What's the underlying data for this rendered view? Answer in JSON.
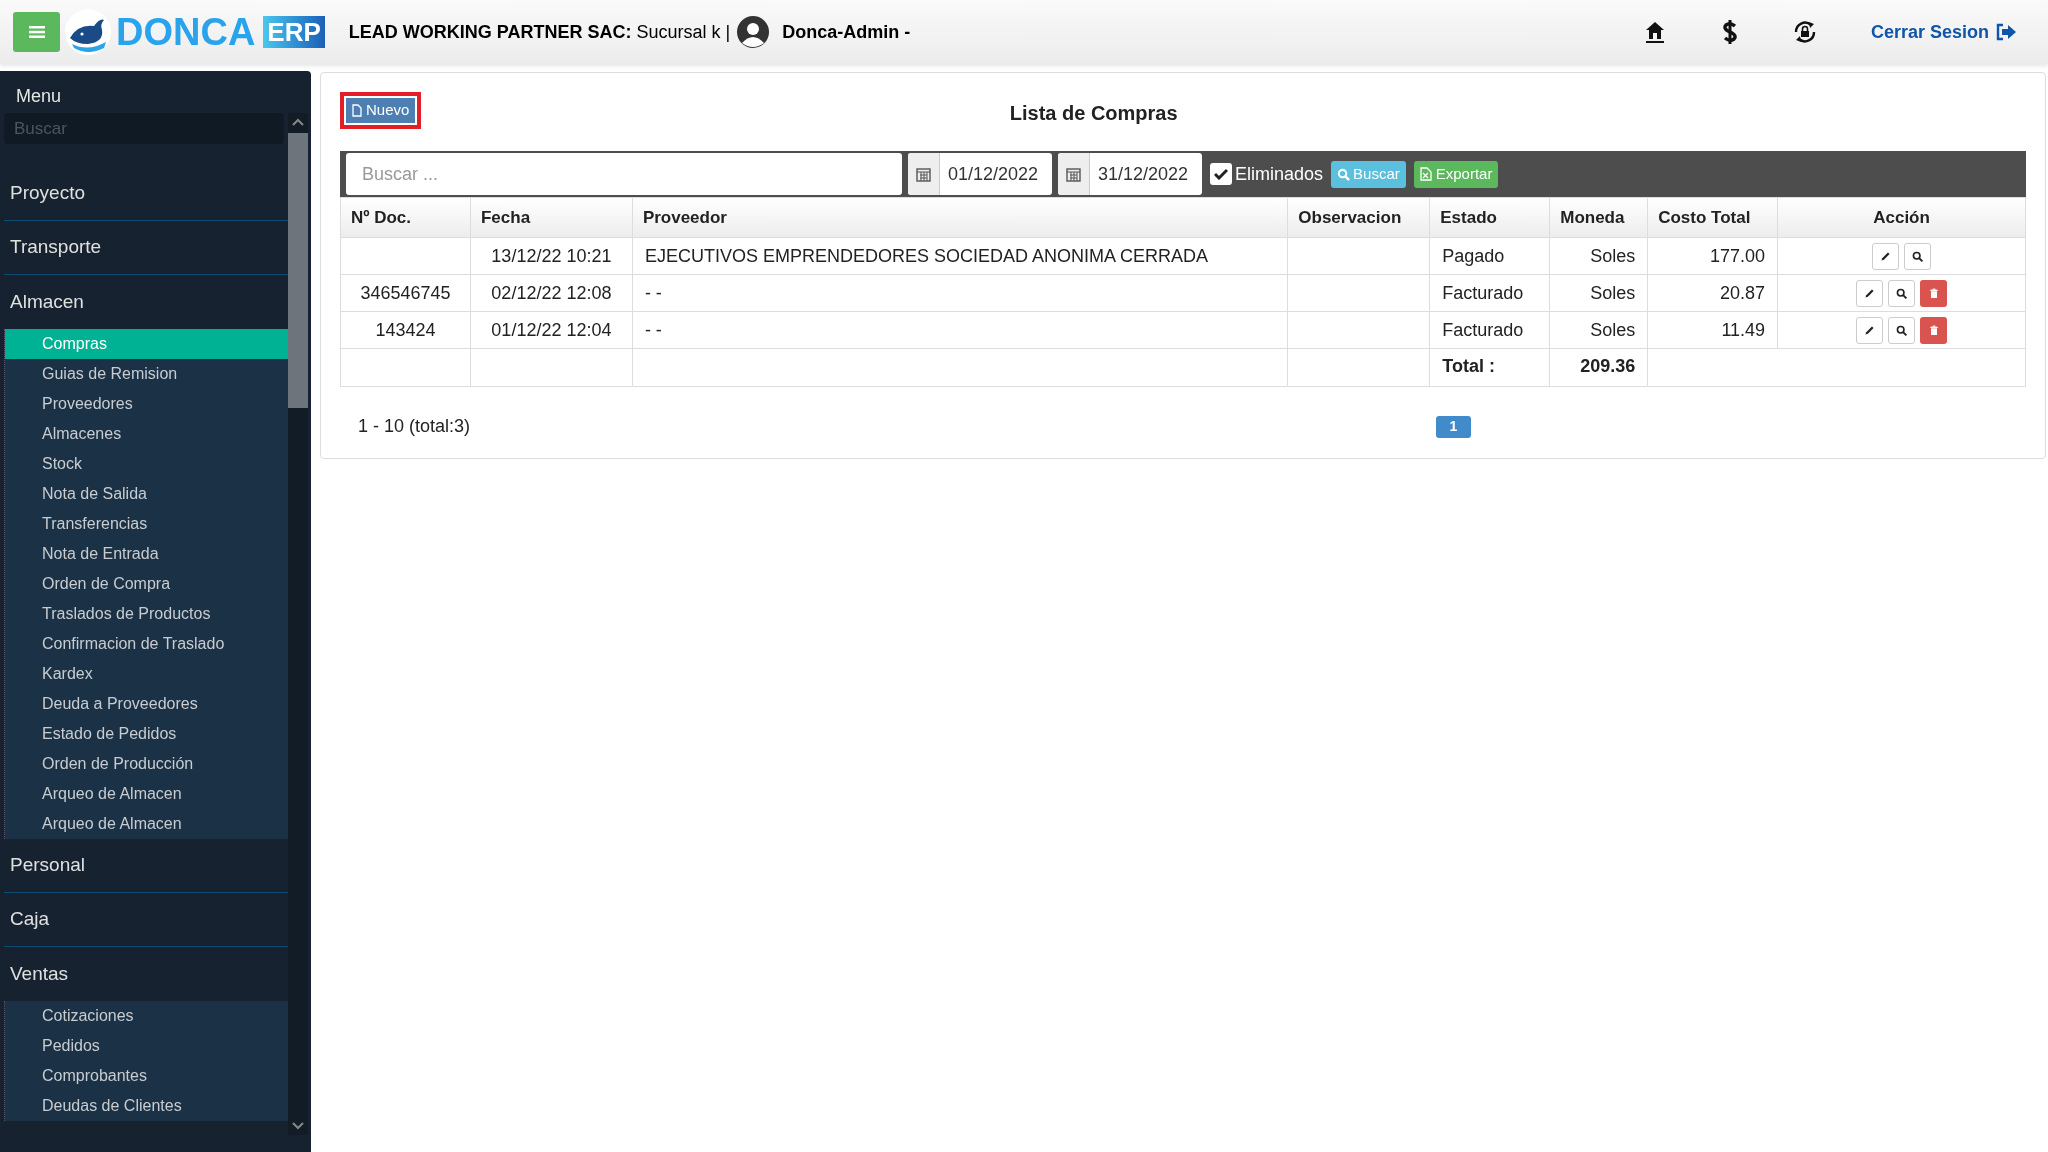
{
  "header": {
    "brand": "DONCA",
    "brand_tag": "ERP",
    "company": "**LEAD WORKING PARTNER SAC:** Sucursal k |",
    "user": "Donca-Admin -",
    "logout": "Cerrar Sesion"
  },
  "sidebar": {
    "title": "Menu",
    "search": {
      "placeholder": "Buscar"
    },
    "items": [
      {
        "label": "Proyecto",
        "expanded": false
      },
      {
        "label": "Transporte",
        "expanded": false
      },
      {
        "label": "Almacen",
        "expanded": true,
        "children": [
          {
            "label": "Compras",
            "selected": true
          },
          {
            "label": "Guias de Remision",
            "selected": false
          },
          {
            "label": "Proveedores",
            "selected": false
          },
          {
            "label": "Almacenes",
            "selected": false
          },
          {
            "label": "Stock",
            "selected": false
          },
          {
            "label": "Nota de Salida",
            "selected": false
          },
          {
            "label": "Transferencias",
            "selected": false
          },
          {
            "label": "Nota de Entrada",
            "selected": false
          },
          {
            "label": "Orden de Compra",
            "selected": false
          },
          {
            "label": "Traslados de Productos",
            "selected": false
          },
          {
            "label": "Confirmacion de Traslado",
            "selected": false
          },
          {
            "label": "Kardex",
            "selected": false
          },
          {
            "label": "Deuda a Proveedores",
            "selected": false
          },
          {
            "label": "Estado de Pedidos",
            "selected": false
          },
          {
            "label": "Orden de Producción",
            "selected": false
          },
          {
            "label": "Arqueo de Almacen",
            "selected": false
          },
          {
            "label": "Arqueo de Almacen",
            "selected": false
          }
        ]
      },
      {
        "label": "Personal",
        "expanded": false
      },
      {
        "label": "Caja",
        "expanded": false
      },
      {
        "label": "Ventas",
        "expanded": true,
        "children": [
          {
            "label": "Cotizaciones",
            "selected": false
          },
          {
            "label": "Pedidos",
            "selected": false
          },
          {
            "label": "Comprobantes",
            "selected": false
          },
          {
            "label": "Deudas de Clientes",
            "selected": false
          }
        ]
      }
    ]
  },
  "page": {
    "new_button": "Nuevo",
    "title": "Lista de Compras"
  },
  "filters": {
    "search": {
      "placeholder": "Buscar ..."
    },
    "date_from": "01/12/2022",
    "date_to": "31/12/2022",
    "deleted": {
      "label": "Eliminados",
      "checked": true
    },
    "search_button": "Buscar",
    "export_button": "Exportar"
  },
  "table": {
    "columns": [
      "Nº Doc.",
      "Fecha",
      "Proveedor",
      "Observacion",
      "Estado",
      "Moneda",
      "Costo Total",
      "Acción"
    ],
    "rows": [
      {
        "doc": "",
        "date": "13/12/22 10:21",
        "supplier": "EJECUTIVOS EMPRENDEDORES SOCIEDAD ANONIMA CERRADA",
        "status": "Pagado",
        "currency": "Soles",
        "total": "177.00",
        "actions": [
          {
            "kind": "edit"
          },
          {
            "kind": "view"
          }
        ]
      },
      {
        "doc": "346546745",
        "date": "02/12/22 12:08",
        "supplier": "- -",
        "status": "Facturado",
        "currency": "Soles",
        "total": "20.87",
        "actions": [
          {
            "kind": "edit"
          },
          {
            "kind": "view"
          },
          {
            "kind": "delete"
          }
        ]
      },
      {
        "doc": "143424",
        "date": "01/12/22 12:04",
        "supplier": "- -",
        "status": "Facturado",
        "currency": "Soles",
        "total": "11.49",
        "actions": [
          {
            "kind": "edit"
          },
          {
            "kind": "view"
          },
          {
            "kind": "delete"
          }
        ]
      }
    ],
    "footer": {
      "label": "Total :",
      "value": "209.36"
    }
  },
  "pagination": {
    "summary": "1 - 10 (total:3)",
    "pages": [
      {
        "label": "1",
        "selected": true
      }
    ]
  }
}
